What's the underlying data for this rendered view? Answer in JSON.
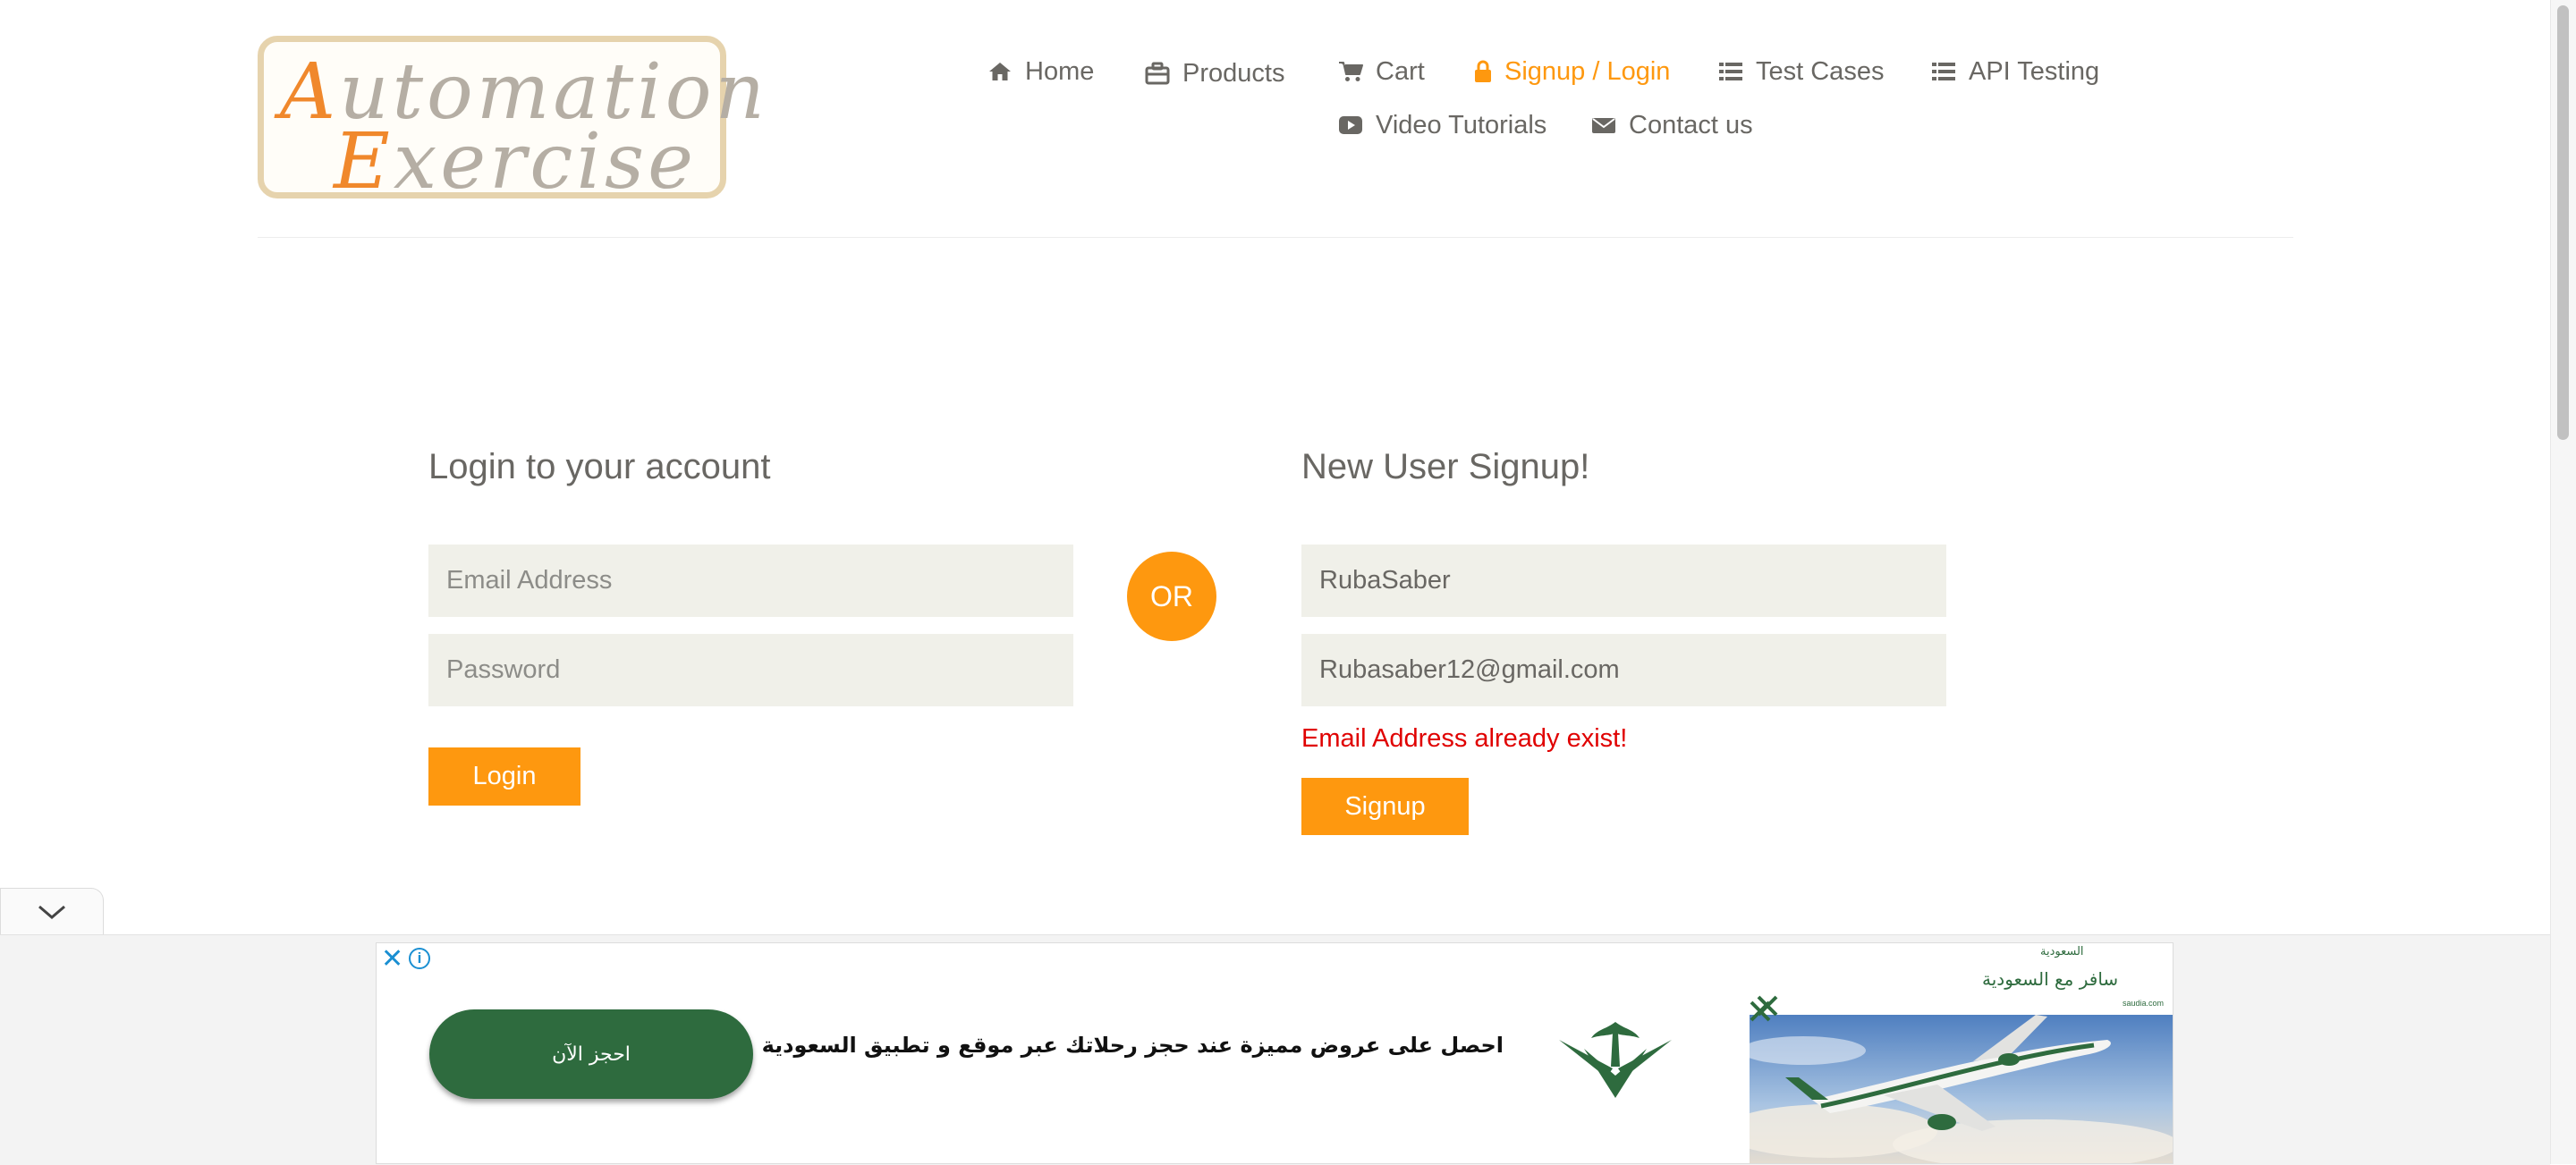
{
  "logo": {
    "line1": "Automation",
    "line2": "Exercise"
  },
  "nav": {
    "items": [
      {
        "label": "Home",
        "icon": "home-icon"
      },
      {
        "label": "Products",
        "icon": "briefcase-icon"
      },
      {
        "label": "Cart",
        "icon": "cart-icon"
      },
      {
        "label": "Signup / Login",
        "icon": "lock-icon",
        "active": true
      },
      {
        "label": "Test Cases",
        "icon": "list-icon"
      },
      {
        "label": "API Testing",
        "icon": "list-icon"
      },
      {
        "label": "Video Tutorials",
        "icon": "youtube-play-icon"
      },
      {
        "label": "Contact us",
        "icon": "envelope-icon"
      }
    ]
  },
  "login": {
    "title": "Login to your account",
    "email_placeholder": "Email Address",
    "password_placeholder": "Password",
    "button": "Login"
  },
  "divider_text": "OR",
  "signup": {
    "title": "New User Signup!",
    "name_value": "RubaSaber",
    "email_value": "Rubasaber12@gmail.com",
    "error": "Email Address already exist!",
    "button": "Signup"
  },
  "ad": {
    "close": "✕",
    "info": "i",
    "cta": "احجز الآن",
    "headline": "احصل على عروض مميزة عند حجز رحلاتك عبر موقع و تطبيق السعودية",
    "brand": "السعودية",
    "tagline": "سافر مع السعودية",
    "site": "saudia.com"
  },
  "colors": {
    "accent": "#fe980f",
    "text": "#696763",
    "field_bg": "#f0f0e9",
    "error": "#e00000",
    "ad_green": "#2e6b3e"
  }
}
